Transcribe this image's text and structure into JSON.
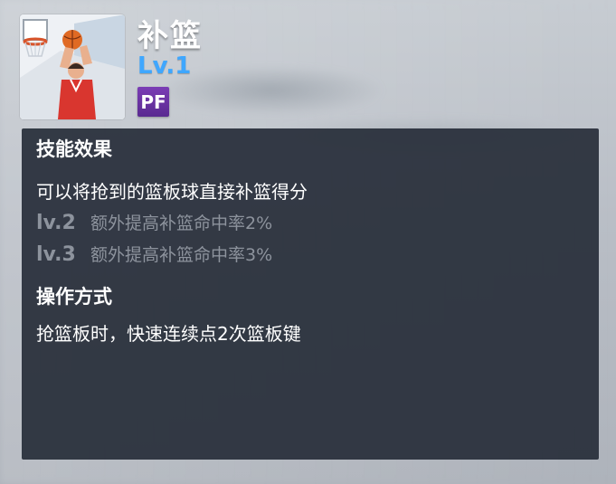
{
  "skill": {
    "name": "补篮",
    "level": "Lv.1",
    "position": "PF",
    "icon": "basketball-player-icon"
  },
  "effect": {
    "heading": "技能效果",
    "description": "可以将抢到的篮板球直接补篮得分",
    "upgrades": [
      {
        "tag": "lv.2",
        "text": "额外提高补篮命中率2%"
      },
      {
        "tag": "lv.3",
        "text": "额外提高补篮命中率3%"
      }
    ]
  },
  "operation": {
    "heading": "操作方式",
    "description": "抢篮板时，快速连续点2次篮板键"
  },
  "colors": {
    "level": "#3fa7ff",
    "badge": "#6a33a3",
    "panel": "#282e3a",
    "muted": "#8d939d"
  }
}
